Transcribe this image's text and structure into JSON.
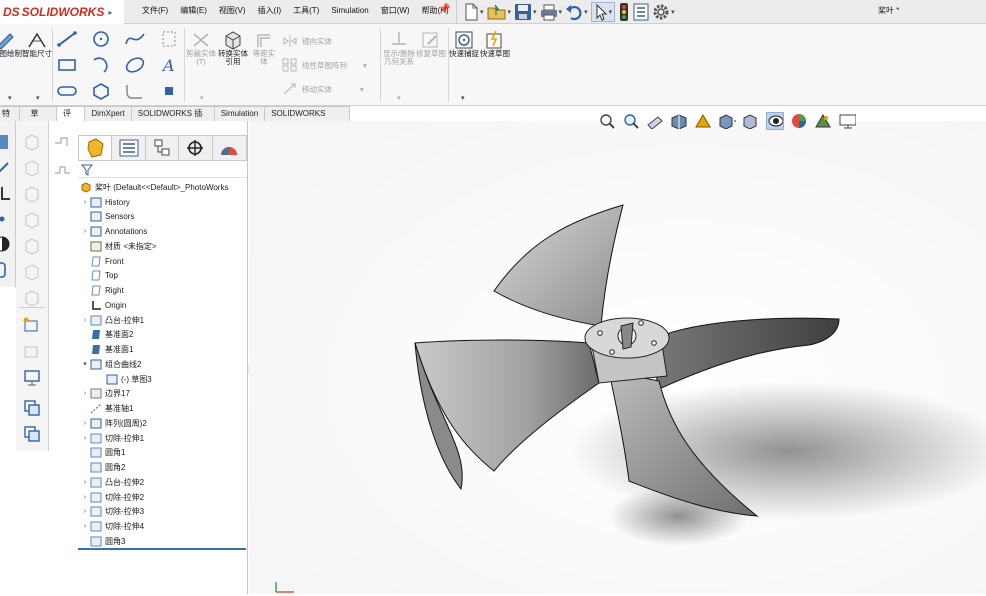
{
  "app": {
    "logo_prefix": "DS",
    "logo_name": "SOLIDWORKS",
    "doc_title": "桨叶 *"
  },
  "menu": [
    "文件(F)",
    "编辑(E)",
    "视图(V)",
    "插入(I)",
    "工具(T)",
    "Simulation",
    "窗口(W)",
    "帮助(H)"
  ],
  "toolbar": {
    "sketch_tool": "草图绘制",
    "smart_dim": "智能尺寸",
    "trim": "剪裁实体(T)",
    "convert": "转换实体引用",
    "offset": "等距实体",
    "mirror": "镜向实体",
    "linear_pattern": "线性草图阵列",
    "move": "移动实体",
    "show_delete": "显示/删除几何关系",
    "repair": "修复草图",
    "quick_snap": "快速捕捉",
    "rapid_sketch": "快速草图"
  },
  "tabs": [
    "特征",
    "草图",
    "评估",
    "DimXpert",
    "SOLIDWORKS 插件",
    "Simulation",
    "SOLIDWORKS MBD"
  ],
  "active_tab_index": 1,
  "tree": {
    "root": "桨叶  (Default<<Default>_PhotoWorks",
    "items": [
      {
        "label": "History",
        "icon": "history-icon",
        "arrow": true
      },
      {
        "label": "Sensors",
        "icon": "sensors-icon",
        "arrow": false
      },
      {
        "label": "Annotations",
        "icon": "annotations-icon",
        "arrow": true
      },
      {
        "label": "材质 <未指定>",
        "icon": "material-icon",
        "arrow": false
      },
      {
        "label": "Front",
        "icon": "plane-icon",
        "arrow": false
      },
      {
        "label": "Top",
        "icon": "plane-icon",
        "arrow": false
      },
      {
        "label": "Right",
        "icon": "plane-icon",
        "arrow": false
      },
      {
        "label": "Origin",
        "icon": "origin-icon",
        "arrow": false
      },
      {
        "label": "凸台-拉伸1",
        "icon": "extrude-icon",
        "arrow": true
      },
      {
        "label": "基准面2",
        "icon": "plane-solid-icon",
        "arrow": false
      },
      {
        "label": "基准面1",
        "icon": "plane-solid-icon",
        "arrow": false
      },
      {
        "label": "组合曲线2",
        "icon": "curve-icon",
        "arrow": true,
        "expanded": true
      },
      {
        "label": "(-) 草图3",
        "icon": "sketch-icon",
        "arrow": false,
        "indent": true
      },
      {
        "label": "边界17",
        "icon": "boundary-icon",
        "arrow": true
      },
      {
        "label": "基准轴1",
        "icon": "axis-icon",
        "arrow": false
      },
      {
        "label": "阵列(圆周)2",
        "icon": "pattern-icon",
        "arrow": true
      },
      {
        "label": "切除-拉伸1",
        "icon": "cut-icon",
        "arrow": true
      },
      {
        "label": "圆角1",
        "icon": "fillet-icon",
        "arrow": false
      },
      {
        "label": "圆角2",
        "icon": "fillet-icon",
        "arrow": false
      },
      {
        "label": "凸台-拉伸2",
        "icon": "extrude-icon",
        "arrow": true
      },
      {
        "label": "切除-拉伸2",
        "icon": "cut-icon",
        "arrow": true
      },
      {
        "label": "切除-拉伸3",
        "icon": "cut-icon",
        "arrow": true
      },
      {
        "label": "切除-拉伸4",
        "icon": "cut-icon",
        "arrow": true
      },
      {
        "label": "圆角3",
        "icon": "fillet-icon",
        "arrow": false
      }
    ]
  },
  "colors": {
    "brand": "#d52b1e",
    "accent": "#3a6ea5"
  }
}
